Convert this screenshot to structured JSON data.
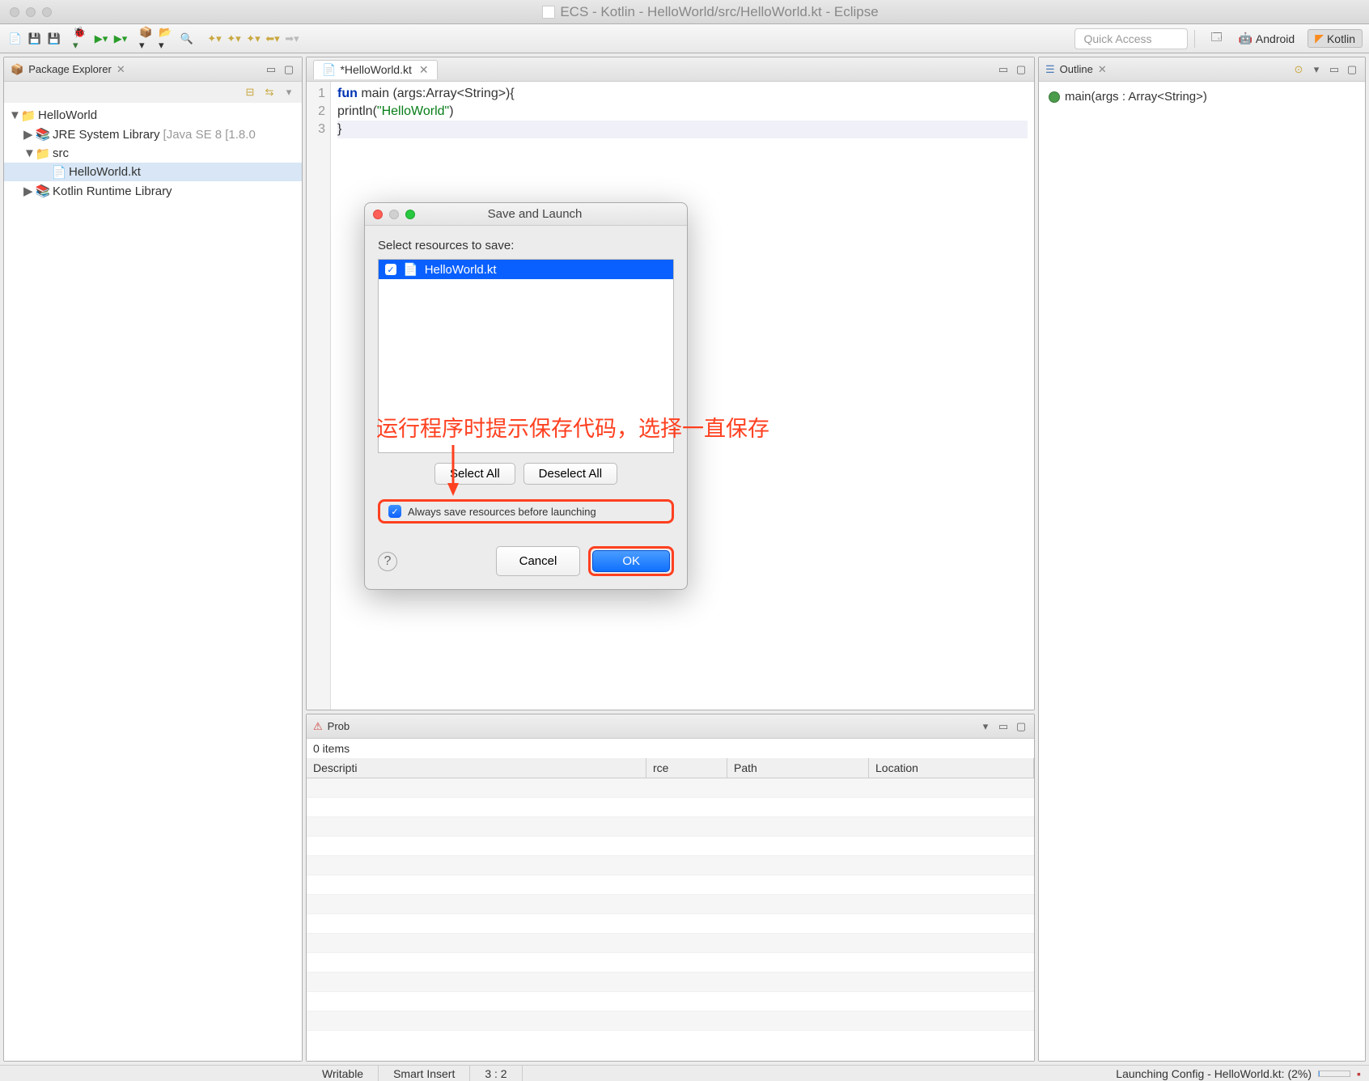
{
  "titlebar": {
    "title": "ECS - Kotlin - HelloWorld/src/HelloWorld.kt - Eclipse"
  },
  "toolbar": {
    "quick_access": "Quick Access",
    "perspectives": {
      "android": "Android",
      "kotlin": "Kotlin"
    }
  },
  "package_explorer": {
    "title": "Package Explorer",
    "project": "HelloWorld",
    "jre": "JRE System Library",
    "jre_meta": "[Java SE 8 [1.8.0",
    "src": "src",
    "file": "HelloWorld.kt",
    "kotlin_lib": "Kotlin Runtime Library"
  },
  "editor": {
    "tab": "*HelloWorld.kt",
    "lines": {
      "l1a": "fun",
      "l1b": " main (args:Array<String>){",
      "l2a": "    println(",
      "l2b": "\"HelloWorld\"",
      "l2c": ")",
      "l3": "}"
    },
    "g1": "1",
    "g2": "2",
    "g3": "3"
  },
  "outline": {
    "title": "Outline",
    "item": "main(args : Array<String>)"
  },
  "problems": {
    "tab": "Prob",
    "count": "0 items",
    "cols": {
      "description": "Descripti",
      "resource": "rce",
      "path": "Path",
      "location": "Location"
    }
  },
  "dialog": {
    "title": "Save and Launch",
    "label": "Select resources to save:",
    "resource": "HelloWorld.kt",
    "select_all": "Select All",
    "deselect_all": "Deselect All",
    "always_save": "Always save resources before launching",
    "cancel": "Cancel",
    "ok": "OK"
  },
  "annotation": {
    "text": "运行程序时提示保存代码，选择一直保存"
  },
  "statusbar": {
    "writable": "Writable",
    "insert": "Smart Insert",
    "pos": "3 : 2",
    "launch": "Launching Config - HelloWorld.kt: (2%)"
  }
}
